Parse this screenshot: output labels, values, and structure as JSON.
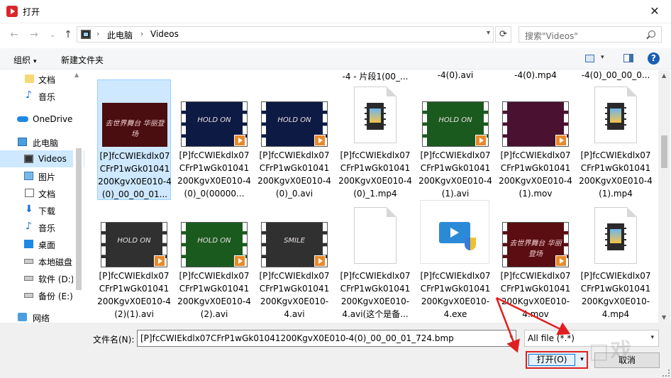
{
  "window": {
    "title": "打开",
    "close_glyph": "✕"
  },
  "nav": {
    "back_glyph": "←",
    "forward_glyph": "→",
    "recent_glyph": "⌄",
    "up_glyph": "↑",
    "breadcrumbs": [
      "此电脑",
      "Videos"
    ],
    "separator": "›",
    "refresh_glyph": "⟳",
    "search_placeholder": "搜索\"Videos\""
  },
  "toolbar": {
    "organize": "组织",
    "new_folder": "新建文件夹",
    "caret": "▾",
    "help": "?"
  },
  "sidebar": {
    "items": [
      {
        "label": "文档",
        "icon": "folder-icon"
      },
      {
        "label": "音乐",
        "icon": "music-icon"
      },
      {
        "label": "OneDrive",
        "icon": "cloud-icon"
      },
      {
        "label": "此电脑",
        "icon": "computer-icon"
      },
      {
        "label": "Videos",
        "icon": "video-folder-icon",
        "selected": true
      },
      {
        "label": "图片",
        "icon": "pictures-icon"
      },
      {
        "label": "文档",
        "icon": "documents-icon"
      },
      {
        "label": "下载",
        "icon": "download-icon"
      },
      {
        "label": "音乐",
        "icon": "music-icon"
      },
      {
        "label": "桌面",
        "icon": "desktop-icon"
      },
      {
        "label": "本地磁盘",
        "icon": "disk-icon"
      },
      {
        "label": "软件 (D:)",
        "icon": "disk-icon"
      },
      {
        "label": "备份 (E:)",
        "icon": "disk-icon"
      },
      {
        "label": "网络",
        "icon": "network-icon"
      }
    ]
  },
  "partial_top_row": [
    "-4 - 片段1(00_...",
    "-4(0).avi",
    "-4(0).mp4",
    "-4(0)_00_00_0...",
    "-4(0).avi",
    "-4(0).mp4",
    "-4(0).mp4"
  ],
  "files": [
    {
      "name": "[P]fcCWIEkdlx07CFrP1wGk01041200KgvX0E010-4(0)_00_00_01...",
      "kind": "bmp",
      "tint": "red",
      "thumb_text": "去世界舞台 华丽登场",
      "selected": true
    },
    {
      "name": "[P]fcCWIEkdlx07CFrP1wGk01041200KgvX0E010-4(0)_0(00000...",
      "kind": "video",
      "tint": "blue",
      "thumb_text": "HOLD ON"
    },
    {
      "name": "[P]fcCWIEkdlx07CFrP1wGk01041200KgvX0E010-4(0)_0.avi",
      "kind": "video",
      "tint": "blue",
      "thumb_text": "HOLD ON"
    },
    {
      "name": "[P]fcCWIEkdlx07CFrP1wGk01041200KgvX0E010-4(0)_1.mp4",
      "kind": "doc"
    },
    {
      "name": "[P]fcCWIEkdlx07CFrP1wGk01041200KgvX0E010-4(1).avi",
      "kind": "video",
      "tint": "green",
      "thumb_text": "HOLD ON"
    },
    {
      "name": "[P]fcCWIEkdlx07CFrP1wGk01041200KgvX0E010-4(1).mov",
      "kind": "video",
      "tint": "pink",
      "thumb_text": ""
    },
    {
      "name": "[P]fcCWIEkdlx07CFrP1wGk01041200KgvX0E010-4(1).mp4",
      "kind": "doc"
    },
    {
      "name": "[P]fcCWIEkdlx07CFrP1wGk01041200KgvX0E010-4(2)(1).avi",
      "kind": "video",
      "tint": "grey",
      "thumb_text": "HOLD ON"
    },
    {
      "name": "[P]fcCWIEkdlx07CFrP1wGk01041200KgvX0E010-4(2).avi",
      "kind": "video",
      "tint": "green",
      "thumb_text": "HOLD ON"
    },
    {
      "name": "[P]fcCWIEkdlx07CFrP1wGk01041200KgvX0E010-4.avi",
      "kind": "video",
      "tint": "grey",
      "thumb_text": "SMILE"
    },
    {
      "name": "[P]fcCWIEkdlx07CFrP1wGk01041200KgvX0E010-4.avi(这个是备...",
      "kind": "blank"
    },
    {
      "name": "[P]fcCWIEkdlx07CFrP1wGk01041200KgvX0E010-4.exe",
      "kind": "exe"
    },
    {
      "name": "[P]fcCWIEkdlx07CFrP1wGk01041200KgvX0E010-4.mov",
      "kind": "video",
      "tint": "red",
      "thumb_text": "去世界舞台 华丽登场"
    },
    {
      "name": "[P]fcCWIEkdlx07CFrP1wGk01041200KgvX0E010-4.mp4",
      "kind": "doc"
    }
  ],
  "footer": {
    "filename_label": "文件名(N):",
    "filename_value": "[P]fcCWIEkdlx07CFrP1wGk01041200KgvX0E010-4(0)_00_00_01_724.bmp",
    "filetype_value": "All file (*.*)",
    "open_label": "打开(O)",
    "cancel_label": "取消",
    "dropdown_glyph": "▾"
  },
  "colors": {
    "selection": "#cde8ff",
    "annotation": "#e02020",
    "accent": "#0078d7"
  }
}
